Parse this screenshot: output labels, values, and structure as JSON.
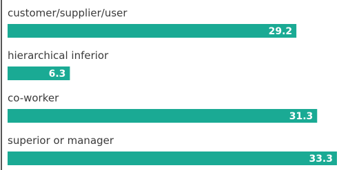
{
  "chart_data": {
    "type": "bar",
    "orientation": "horizontal",
    "categories": [
      "customer/supplier/user",
      "hierarchical inferior",
      "co-worker",
      "superior or manager"
    ],
    "values": [
      29.2,
      6.3,
      31.3,
      33.3
    ],
    "value_labels": [
      "29.2",
      "6.3",
      "31.3",
      "33.3"
    ],
    "xlim": [
      0,
      33.3
    ],
    "grid": false,
    "legend": "none",
    "title": "",
    "xlabel": "",
    "ylabel": ""
  },
  "colors": {
    "bar": "#1aaa94",
    "label_text": "#3a3a3a",
    "value_text": "#ffffff",
    "axis_line": "#555555"
  }
}
